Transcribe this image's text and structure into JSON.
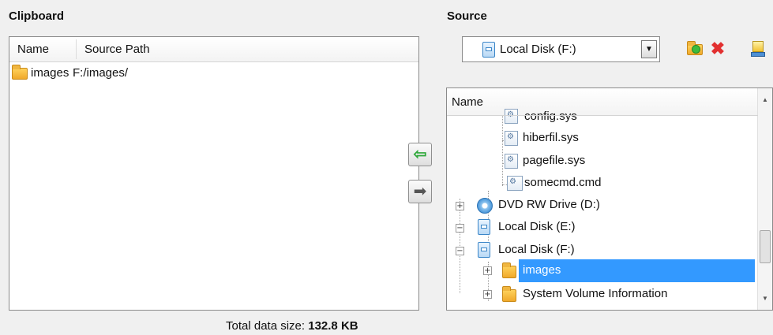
{
  "clipboard": {
    "title": "Clipboard",
    "columns": [
      "Name",
      "Source Path"
    ],
    "rows": [
      {
        "name": "images",
        "path": "F:/images/",
        "icon": "folder-icon"
      }
    ],
    "total_label": "Total data size:",
    "total_value": "132.8 KB"
  },
  "transfer": {
    "add_icon": "arrow-left-icon",
    "remove_icon": "arrow-right-icon"
  },
  "source": {
    "title": "Source",
    "drive_select": {
      "selected": "Local Disk (F:)",
      "icon": "drive-icon"
    },
    "toolbar": [
      "new-folder-icon",
      "delete-icon",
      "properties-icon"
    ],
    "tree": {
      "column": "Name",
      "items": [
        {
          "label": "config.sys",
          "type": "file"
        },
        {
          "label": "hiberfil.sys",
          "type": "file"
        },
        {
          "label": "pagefile.sys",
          "type": "file"
        },
        {
          "label": "somecmd.cmd",
          "type": "file"
        },
        {
          "label": "DVD RW Drive (D:)",
          "type": "dvd",
          "expander": "+"
        },
        {
          "label": "Local Disk (E:)",
          "type": "drive",
          "expander": "−"
        },
        {
          "label": "Local Disk (F:)",
          "type": "drive",
          "expander": "−"
        },
        {
          "label": "images",
          "type": "folder",
          "expander": "+",
          "selected": true
        },
        {
          "label": "System Volume Information",
          "type": "folder",
          "expander": "+"
        }
      ]
    }
  },
  "colors": {
    "selection": "#3399ff",
    "background": "#f0f0f0"
  }
}
